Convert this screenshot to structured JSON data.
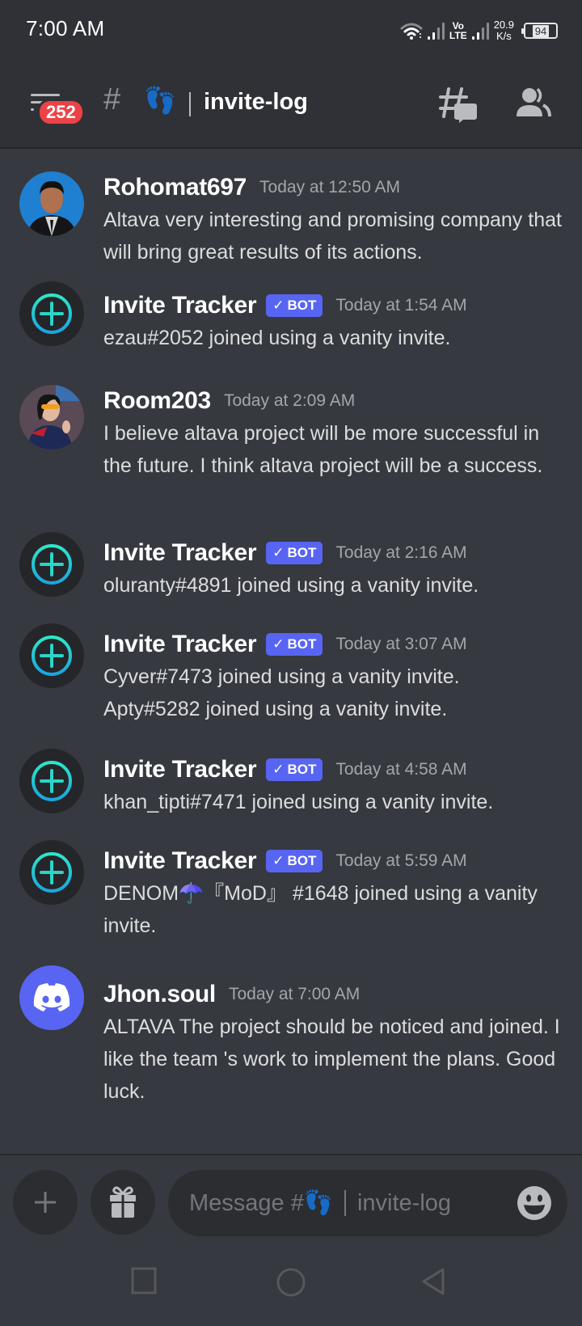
{
  "status_bar": {
    "time": "7:00 AM",
    "network_top": "Vo",
    "network_bottom": "LTE",
    "speed_value": "20.9",
    "speed_unit": "K/s",
    "battery": "94"
  },
  "header": {
    "unread_badge": "252",
    "channel_prefix": "#",
    "channel_emoji": "👣",
    "channel_name": "invite-log"
  },
  "colors": {
    "bot_badge": "#5865f2",
    "unread_badge": "#ed4245",
    "invite_tracker_accent": "#2bd5c8",
    "discord_blurple": "#5865f2"
  },
  "messages": [
    {
      "author": "Rohomat697",
      "timestamp": "Today at 12:50 AM",
      "is_bot": false,
      "avatar": "photo-man-blue-background",
      "lines": [
        "Altava very interesting and promising company that will bring great results of its actions."
      ]
    },
    {
      "author": "Invite Tracker",
      "timestamp": "Today at 1:54 AM",
      "is_bot": true,
      "bot_label": "BOT",
      "avatar": "invite-tracker-plus-icon",
      "lines": [
        "ezau#2052 joined using a vanity invite."
      ]
    },
    {
      "author": "Room203",
      "timestamp": "Today at 2:09 AM",
      "is_bot": false,
      "avatar": "photo-woman-sunglasses",
      "lines": [
        "I believe altava  project will be more successful in the future. I think altava project will be a success."
      ]
    },
    {
      "author": "Invite Tracker",
      "timestamp": "Today at 2:16 AM",
      "is_bot": true,
      "bot_label": "BOT",
      "avatar": "invite-tracker-plus-icon",
      "lines": [
        "oluranty#4891 joined using a vanity invite."
      ]
    },
    {
      "author": "Invite Tracker",
      "timestamp": "Today at 3:07 AM",
      "is_bot": true,
      "bot_label": "BOT",
      "avatar": "invite-tracker-plus-icon",
      "lines": [
        "Cyver#7473 joined using a vanity invite.",
        "Apty#5282 joined using a vanity invite."
      ]
    },
    {
      "author": "Invite Tracker",
      "timestamp": "Today at 4:58 AM",
      "is_bot": true,
      "bot_label": "BOT",
      "avatar": "invite-tracker-plus-icon",
      "lines": [
        "khan_tipti#7471 joined using a vanity invite."
      ]
    },
    {
      "author": "Invite Tracker",
      "timestamp": "Today at 5:59 AM",
      "is_bot": true,
      "bot_label": "BOT",
      "avatar": "invite-tracker-plus-icon",
      "lines": [
        "DENOM☂️『MoD』 #1648 joined using a vanity invite."
      ]
    },
    {
      "author": "Jhon.soul",
      "timestamp": "Today at 7:00 AM",
      "is_bot": false,
      "avatar": "discord-default-avatar",
      "lines": [
        "ALTAVA The project should be noticed and joined. I like the team 's work to implement the plans. Good luck."
      ]
    }
  ],
  "composer": {
    "placeholder_prefix": "Message #",
    "placeholder_emoji": "👣",
    "placeholder_channel": "invite-log",
    "attach_icon": "plus-icon",
    "gift_icon": "gift-icon",
    "emoji_icon": "smiley-icon"
  },
  "nav": {
    "recents_icon": "square-icon",
    "home_icon": "circle-icon",
    "back_icon": "triangle-back-icon"
  }
}
